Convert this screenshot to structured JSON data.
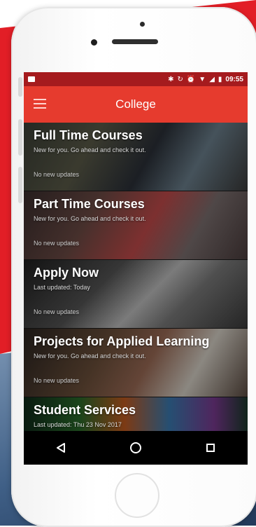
{
  "status_bar": {
    "time": "09:55",
    "icons": [
      "bluetooth-icon",
      "sync-icon",
      "alarm-icon",
      "wifi-icon",
      "signal-icon",
      "battery-icon"
    ]
  },
  "app_bar": {
    "title": "College",
    "menu_icon": "hamburger-menu-icon"
  },
  "cards": [
    {
      "title": "Full Time Courses",
      "subtitle": "New for you. Go ahead and check it out.",
      "update": "No new updates"
    },
    {
      "title": "Part Time Courses",
      "subtitle": "New for you. Go ahead and check it out.",
      "update": "No new updates"
    },
    {
      "title": "Apply Now",
      "subtitle": "Last updated: Today",
      "update": "No new updates"
    },
    {
      "title": "Projects for Applied Learning",
      "subtitle": "New for you. Go ahead and check it out.",
      "update": "No new updates"
    },
    {
      "title": "Student Services",
      "subtitle": "Last updated: Thu 23 Nov 2017",
      "update": ""
    }
  ],
  "nav_bar": {
    "back": "back-triangle-icon",
    "home": "home-circle-icon",
    "recents": "recents-square-icon"
  },
  "colors": {
    "brand_red": "#e21e26",
    "app_bar": "#e63b2e",
    "status_bar": "#a51b1e"
  }
}
